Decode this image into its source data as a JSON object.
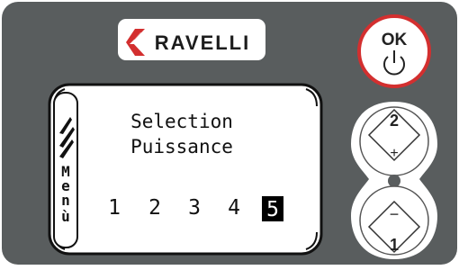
{
  "brand": {
    "name": "RAVELLI",
    "accent": "#d32f2f"
  },
  "colors": {
    "panel": "#595d5e",
    "screen_bg": "#ffffff",
    "screen_border": "#111111",
    "selected_bg": "#000000",
    "selected_fg": "#ffffff",
    "ok_ring": "#d32f2f"
  },
  "display": {
    "side_label_letters": [
      "M",
      "e",
      "n",
      "ù"
    ],
    "title_line1": "Selection",
    "title_line2": "Puissance",
    "levels": [
      "1",
      "2",
      "3",
      "4",
      "5"
    ],
    "selected_level": "5"
  },
  "buttons": {
    "ok": {
      "label": "OK",
      "icon": "power-icon"
    },
    "plus": {
      "number": "2",
      "symbol": "+"
    },
    "minus": {
      "number": "1",
      "symbol": "−"
    }
  }
}
